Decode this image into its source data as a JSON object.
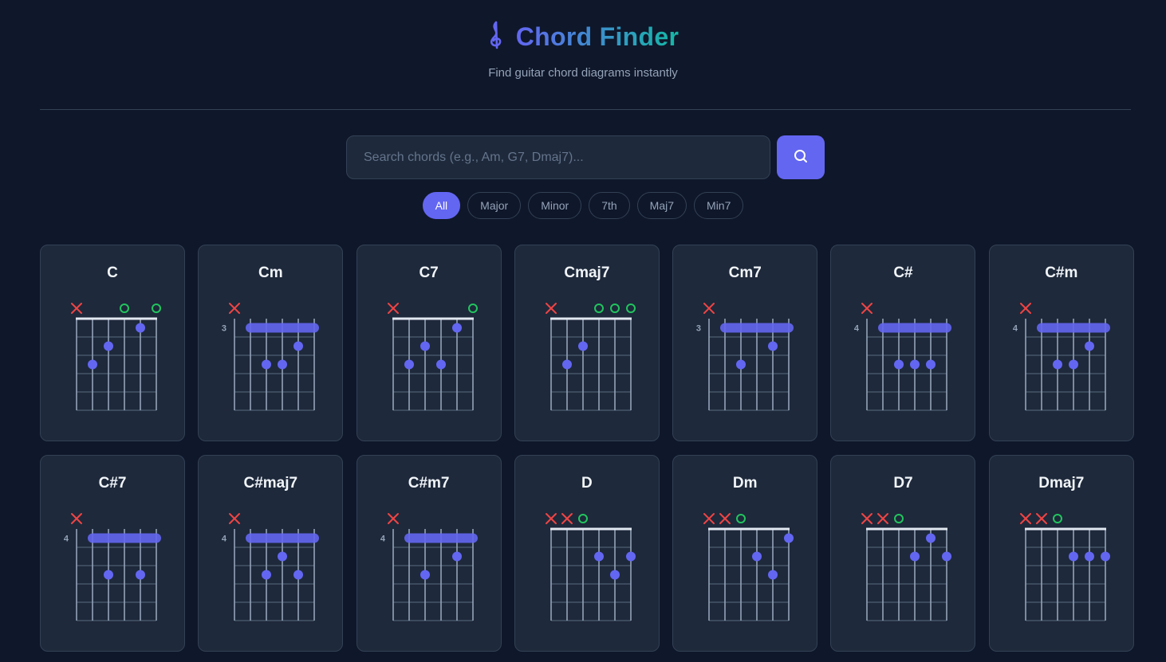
{
  "header": {
    "title": "Chord Finder",
    "subtitle": "Find guitar chord diagrams instantly",
    "logo_icon": "music-note-icon"
  },
  "search": {
    "placeholder": "Search chords (e.g., Am, G7, Dmaj7)...",
    "value": "",
    "button_icon": "search-icon"
  },
  "filters": [
    {
      "label": "All",
      "active": true
    },
    {
      "label": "Major",
      "active": false
    },
    {
      "label": "Minor",
      "active": false
    },
    {
      "label": "7th",
      "active": false
    },
    {
      "label": "Maj7",
      "active": false
    },
    {
      "label": "Min7",
      "active": false
    }
  ],
  "colors": {
    "accent": "#6366f1",
    "muted_marker": "#ef4444",
    "open_marker": "#22c55e",
    "background": "#0f172a",
    "card": "#1e293b"
  },
  "chords": [
    {
      "name": "C",
      "baseFret": 1,
      "frets": [
        "x",
        3,
        2,
        0,
        1,
        0
      ],
      "barre": null
    },
    {
      "name": "Cm",
      "baseFret": 3,
      "frets": [
        "x",
        1,
        3,
        3,
        2,
        1
      ],
      "barre": {
        "fret": 1,
        "from": 1,
        "to": 5
      }
    },
    {
      "name": "C7",
      "baseFret": 1,
      "frets": [
        "x",
        3,
        2,
        3,
        1,
        0
      ],
      "barre": null
    },
    {
      "name": "Cmaj7",
      "baseFret": 1,
      "frets": [
        "x",
        3,
        2,
        0,
        0,
        0
      ],
      "barre": null
    },
    {
      "name": "Cm7",
      "baseFret": 3,
      "frets": [
        "x",
        1,
        3,
        1,
        2,
        1
      ],
      "barre": {
        "fret": 1,
        "from": 1,
        "to": 5
      }
    },
    {
      "name": "C#",
      "baseFret": 4,
      "frets": [
        "x",
        1,
        3,
        3,
        3,
        1
      ],
      "barre": {
        "fret": 1,
        "from": 1,
        "to": 5
      }
    },
    {
      "name": "C#m",
      "baseFret": 4,
      "frets": [
        "x",
        1,
        3,
        3,
        2,
        1
      ],
      "barre": {
        "fret": 1,
        "from": 1,
        "to": 5
      }
    },
    {
      "name": "C#7",
      "baseFret": 4,
      "frets": [
        "x",
        1,
        3,
        1,
        3,
        1
      ],
      "barre": {
        "fret": 1,
        "from": 1,
        "to": 5
      }
    },
    {
      "name": "C#maj7",
      "baseFret": 4,
      "frets": [
        "x",
        1,
        3,
        2,
        3,
        1
      ],
      "barre": {
        "fret": 1,
        "from": 1,
        "to": 5
      }
    },
    {
      "name": "C#m7",
      "baseFret": 4,
      "frets": [
        "x",
        1,
        3,
        1,
        2,
        1
      ],
      "barre": {
        "fret": 1,
        "from": 1,
        "to": 5
      }
    },
    {
      "name": "D",
      "baseFret": 1,
      "frets": [
        "x",
        "x",
        0,
        2,
        3,
        2
      ],
      "barre": null
    },
    {
      "name": "Dm",
      "baseFret": 1,
      "frets": [
        "x",
        "x",
        0,
        2,
        3,
        1
      ],
      "barre": null
    },
    {
      "name": "D7",
      "baseFret": 1,
      "frets": [
        "x",
        "x",
        0,
        2,
        1,
        2
      ],
      "barre": null
    },
    {
      "name": "Dmaj7",
      "baseFret": 1,
      "frets": [
        "x",
        "x",
        0,
        2,
        2,
        2
      ],
      "barre": null
    }
  ]
}
